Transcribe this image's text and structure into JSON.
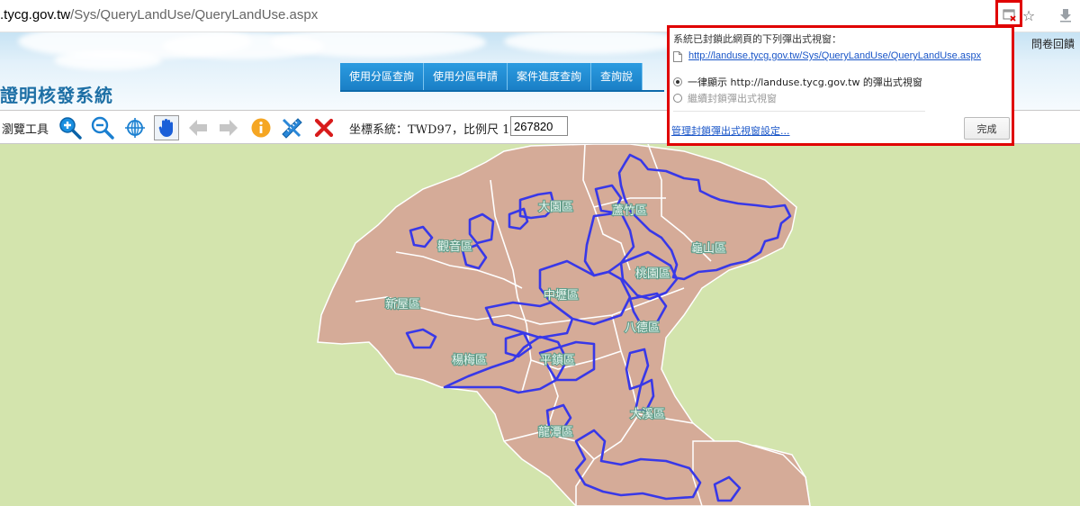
{
  "browser": {
    "url_host": ".tycg.gov.tw",
    "url_path": "/Sys/QueryLandUse/QueryLandUse.aspx"
  },
  "site": {
    "title": "證明核發系統",
    "feedback": "問卷回饋",
    "nav": [
      "使用分區查詢",
      "使用分區申請",
      "案件進度查詢",
      "查詢說"
    ]
  },
  "toolbar": {
    "label": "瀏覽工具",
    "coord_text": "坐標系統：TWD97，比例尺 1：",
    "scale_value": "267820"
  },
  "map": {
    "districts": [
      "大園區",
      "蘆竹區",
      "龜山區",
      "觀音區",
      "桃園區",
      "新屋區",
      "中壢區",
      "八德區",
      "楊梅區",
      "平鎮區",
      "大溪區",
      "龍潭區"
    ],
    "colors": {
      "background": "#d3e4ad",
      "district_fill": "#d5ab98",
      "district_border": "#ffffff",
      "overlay": "#3838e8"
    }
  },
  "popup": {
    "heading": "系統已封鎖此網頁的下列彈出式視窗：",
    "link": "http://landuse.tycg.gov.tw/Sys/QueryLandUse/QueryLandUse.aspx",
    "option_allow": "一律顯示 http://landuse.tycg.gov.tw 的彈出式視窗",
    "option_block": "繼續封鎖彈出式視窗",
    "manage": "管理封鎖彈出式視窗設定...",
    "done": "完成"
  }
}
